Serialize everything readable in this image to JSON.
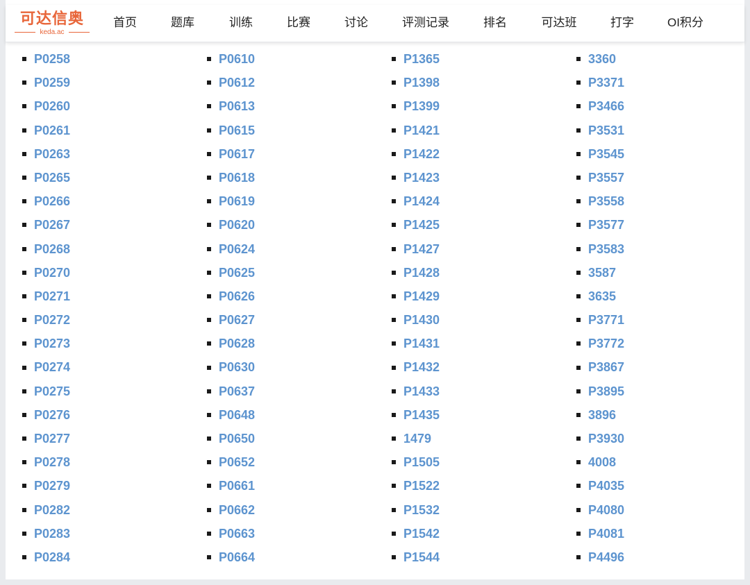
{
  "header": {
    "logo_text": "可达信奥",
    "logo_subtext": "keda.ac",
    "nav": [
      "首页",
      "题库",
      "训练",
      "比赛",
      "讨论",
      "评测记录",
      "排名",
      "可达班",
      "打字",
      "OI积分"
    ]
  },
  "problem_columns": [
    [
      "P0258",
      "P0259",
      "P0260",
      "P0261",
      "P0263",
      "P0265",
      "P0266",
      "P0267",
      "P0268",
      "P0270",
      "P0271",
      "P0272",
      "P0273",
      "P0274",
      "P0275",
      "P0276",
      "P0277",
      "P0278",
      "P0279",
      "P0282",
      "P0283",
      "P0284"
    ],
    [
      "P0610",
      "P0612",
      "P0613",
      "P0615",
      "P0617",
      "P0618",
      "P0619",
      "P0620",
      "P0624",
      "P0625",
      "P0626",
      "P0627",
      "P0628",
      "P0630",
      "P0637",
      "P0648",
      "P0650",
      "P0652",
      "P0661",
      "P0662",
      "P0663",
      "P0664"
    ],
    [
      "P1365",
      "P1398",
      "P1399",
      "P1421",
      "P1422",
      "P1423",
      "P1424",
      "P1425",
      "P1427",
      "P1428",
      "P1429",
      "P1430",
      "P1431",
      "P1432",
      "P1433",
      "P1435",
      "1479",
      "P1505",
      "P1522",
      "P1532",
      "P1542",
      "P1544"
    ],
    [
      "3360",
      "P3371",
      "P3466",
      "P3531",
      "P3545",
      "P3557",
      "P3558",
      "P3577",
      "P3583",
      "3587",
      "3635",
      "P3771",
      "P3772",
      "P3867",
      "P3895",
      "3896",
      "P3930",
      "4008",
      "P4035",
      "P4080",
      "P4081",
      "P4496"
    ]
  ],
  "colors": {
    "brand": "#e8663a",
    "link": "#5d94cf",
    "page_bg": "#e9ebee",
    "card_bg": "#ffffff"
  }
}
